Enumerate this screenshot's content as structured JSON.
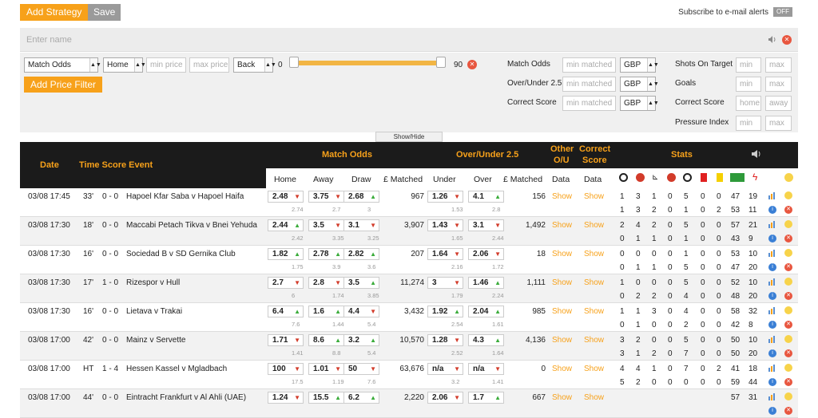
{
  "toolbar": {
    "add_strategy": "Add Strategy",
    "save": "Save",
    "subscribe": "Subscribe to e-mail alerts",
    "toggle": "OFF"
  },
  "name_field": {
    "placeholder": "Enter name"
  },
  "filters": {
    "market": "Match Odds",
    "side": "Home",
    "min_price": "min price",
    "max_price": "max price",
    "back_lay": "Back",
    "range_min": "0",
    "range_max": "90",
    "add_price_filter": "Add Price Filter",
    "matched": [
      {
        "label": "Match Odds",
        "min": "min matched",
        "currency": "GBP"
      },
      {
        "label": "Over/Under 2.5",
        "min": "min matched",
        "currency": "GBP"
      },
      {
        "label": "Correct Score",
        "min": "min matched",
        "currency": "GBP"
      }
    ],
    "stats": [
      {
        "label": "Shots On Target",
        "a": "min",
        "b": "max"
      },
      {
        "label": "Goals",
        "a": "min",
        "b": "max"
      },
      {
        "label": "Correct Score",
        "a": "home",
        "b": "away"
      },
      {
        "label": "Pressure Index",
        "a": "min",
        "b": "max"
      }
    ]
  },
  "show_hide": "Show/Hide",
  "header": {
    "date": "Date",
    "time_score_event": "Time Score Event",
    "match_odds": "Match Odds",
    "over_under": "Over/Under 2.5",
    "other_ou_1": "Other",
    "other_ou_2": "O/U",
    "correct_score_1": "Correct",
    "correct_score_2": "Score",
    "stats": "Stats",
    "home": "Home",
    "away": "Away",
    "draw": "Draw",
    "matched": "£ Matched",
    "under": "Under",
    "over": "Over",
    "matched2": "£ Matched",
    "data1": "Data",
    "data2": "Data"
  },
  "colors": {
    "accent": "#f7a11a",
    "header_bg": "#1b1b1b",
    "up": "#3bac3b",
    "down": "#d23b2a"
  },
  "rows": [
    {
      "date": "03/08 17:45",
      "time": "33'",
      "score": "0 - 0",
      "event": "Hapoel Kfar Saba v Hapoel Haifa",
      "home": "2.48",
      "home_d": "dn",
      "home_s": "2.74",
      "away": "3.75",
      "away_d": "dn",
      "away_s": "2.7",
      "draw": "2.68",
      "draw_d": "up",
      "draw_s": "3",
      "matched": "967",
      "under": "1.26",
      "under_d": "dn",
      "under_s": "1.53",
      "over": "4.1",
      "over_d": "up",
      "over_s": "2.8",
      "matched2": "156",
      "show1": "Show",
      "show2": "Show",
      "s1": [
        "1",
        "3",
        "1",
        "0",
        "5",
        "0",
        "0",
        "47",
        "19"
      ],
      "s2": [
        "1",
        "3",
        "2",
        "0",
        "1",
        "0",
        "2",
        "53",
        "11"
      ]
    },
    {
      "date": "03/08 17:30",
      "time": "18'",
      "score": "0 - 0",
      "event": "Maccabi Petach Tikva v Bnei Yehuda",
      "home": "2.44",
      "home_d": "up",
      "home_s": "2.42",
      "away": "3.5",
      "away_d": "dn",
      "away_s": "3.35",
      "draw": "3.1",
      "draw_d": "dn",
      "draw_s": "3.25",
      "matched": "3,907",
      "under": "1.43",
      "under_d": "dn",
      "under_s": "1.65",
      "over": "3.1",
      "over_d": "dn",
      "over_s": "2.44",
      "matched2": "1,492",
      "show1": "Show",
      "show2": "Show",
      "s1": [
        "2",
        "4",
        "2",
        "0",
        "5",
        "0",
        "0",
        "57",
        "21"
      ],
      "s2": [
        "0",
        "1",
        "1",
        "0",
        "1",
        "0",
        "0",
        "43",
        "9"
      ]
    },
    {
      "date": "03/08 17:30",
      "time": "16'",
      "score": "0 - 0",
      "event": "Sociedad B v SD Gernika Club",
      "home": "1.82",
      "home_d": "up",
      "home_s": "1.75",
      "away": "2.78",
      "away_d": "up",
      "away_s": "3.9",
      "draw": "2.82",
      "draw_d": "up",
      "draw_s": "3.6",
      "matched": "207",
      "under": "1.64",
      "under_d": "dn",
      "under_s": "2.16",
      "over": "2.06",
      "over_d": "dn",
      "over_s": "1.72",
      "matched2": "18",
      "show1": "Show",
      "show2": "Show",
      "s1": [
        "0",
        "0",
        "0",
        "0",
        "1",
        "0",
        "0",
        "53",
        "10"
      ],
      "s2": [
        "0",
        "1",
        "1",
        "0",
        "5",
        "0",
        "0",
        "47",
        "20"
      ]
    },
    {
      "date": "03/08 17:30",
      "time": "17'",
      "score": "1 - 0",
      "event": "Rizespor v Hull",
      "home": "2.7",
      "home_d": "dn",
      "home_s": "6",
      "away": "2.8",
      "away_d": "dn",
      "away_s": "1.74",
      "draw": "3.5",
      "draw_d": "up",
      "draw_s": "3.85",
      "matched": "11,274",
      "under": "3",
      "under_d": "dn",
      "under_s": "1.79",
      "over": "1.46",
      "over_d": "up",
      "over_s": "2.24",
      "matched2": "1,111",
      "show1": "Show",
      "show2": "Show",
      "s1": [
        "1",
        "0",
        "0",
        "0",
        "5",
        "0",
        "0",
        "52",
        "10"
      ],
      "s2": [
        "0",
        "2",
        "2",
        "0",
        "4",
        "0",
        "0",
        "48",
        "20"
      ]
    },
    {
      "date": "03/08 17:30",
      "time": "16'",
      "score": "0 - 0",
      "event": "Lietava v Trakai",
      "home": "6.4",
      "home_d": "up",
      "home_s": "7.6",
      "away": "1.6",
      "away_d": "up",
      "away_s": "1.44",
      "draw": "4.4",
      "draw_d": "dn",
      "draw_s": "5.4",
      "matched": "3,432",
      "under": "1.92",
      "under_d": "up",
      "under_s": "2.54",
      "over": "2.04",
      "over_d": "up",
      "over_s": "1.61",
      "matched2": "985",
      "show1": "Show",
      "show2": "Show",
      "s1": [
        "1",
        "1",
        "3",
        "0",
        "4",
        "0",
        "0",
        "58",
        "32"
      ],
      "s2": [
        "0",
        "1",
        "0",
        "0",
        "2",
        "0",
        "0",
        "42",
        "8"
      ]
    },
    {
      "date": "03/08 17:00",
      "time": "42'",
      "score": "0 - 0",
      "event": "Mainz v Servette",
      "home": "1.71",
      "home_d": "dn",
      "home_s": "1.41",
      "away": "8.6",
      "away_d": "up",
      "away_s": "8.8",
      "draw": "3.2",
      "draw_d": "up",
      "draw_s": "5.4",
      "matched": "10,570",
      "under": "1.28",
      "under_d": "dn",
      "under_s": "2.52",
      "over": "4.3",
      "over_d": "up",
      "over_s": "1.64",
      "matched2": "4,136",
      "show1": "Show",
      "show2": "Show",
      "s1": [
        "3",
        "2",
        "0",
        "0",
        "5",
        "0",
        "0",
        "50",
        "10"
      ],
      "s2": [
        "3",
        "1",
        "2",
        "0",
        "7",
        "0",
        "0",
        "50",
        "20"
      ]
    },
    {
      "date": "03/08 17:00",
      "time": "HT",
      "score": "1 - 4",
      "event": "Hessen Kassel v Mgladbach",
      "home": "100",
      "home_d": "dn",
      "home_s": "17.5",
      "away": "1.01",
      "away_d": "dn",
      "away_s": "1.19",
      "draw": "50",
      "draw_d": "dn",
      "draw_s": "7.6",
      "matched": "63,676",
      "under": "n/a",
      "under_d": "dn",
      "under_s": "3.2",
      "over": "n/a",
      "over_d": "dn",
      "over_s": "1.41",
      "matched2": "0",
      "show1": "Show",
      "show2": "Show",
      "s1": [
        "4",
        "4",
        "1",
        "0",
        "7",
        "0",
        "2",
        "41",
        "18"
      ],
      "s2": [
        "5",
        "2",
        "0",
        "0",
        "0",
        "0",
        "0",
        "59",
        "44"
      ]
    },
    {
      "date": "03/08 17:00",
      "time": "44'",
      "score": "0 - 0",
      "event": "Eintracht Frankfurt v Al Ahli (UAE)",
      "home": "1.24",
      "home_d": "dn",
      "home_s": "",
      "away": "15.5",
      "away_d": "up",
      "away_s": "",
      "draw": "6.2",
      "draw_d": "up",
      "draw_s": "",
      "matched": "2,220",
      "under": "2.06",
      "under_d": "dn",
      "under_s": "",
      "over": "1.7",
      "over_d": "up",
      "over_s": "",
      "matched2": "667",
      "show1": "Show",
      "show2": "Show",
      "s1": [
        "",
        "",
        "",
        "",
        "",
        "",
        "",
        "57",
        "31"
      ],
      "s2": [
        "",
        "",
        "",
        "",
        "",
        "",
        "",
        "",
        ""
      ]
    }
  ]
}
